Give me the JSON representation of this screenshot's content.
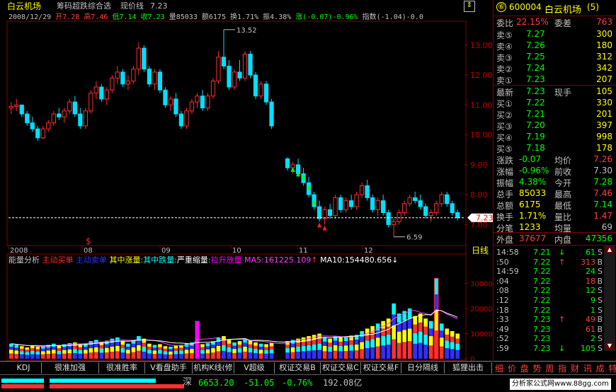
{
  "header": {
    "stock_name": "白云机场",
    "indicator": "筹码超跌综合选",
    "price_line_label": "现价线",
    "price_line_value": "7.23",
    "date": "2008/12/29",
    "open": "开7.28",
    "high": "高7.46",
    "low": "低7.14",
    "close": "收7.23",
    "volume": "量85033",
    "amount": "额6175",
    "turnover": "换1.71%",
    "amplitude": "振4.38%",
    "change": "涨(-0.07)-0.96%",
    "index": "指数(-1.04)-0.0"
  },
  "price_panel": {
    "y_ticks": [
      "13.00",
      "12.00",
      "11.00",
      "10.00",
      "9.00",
      "8.00",
      "7.00"
    ],
    "y_values": [
      13,
      12,
      11,
      10,
      9,
      8,
      7
    ],
    "ymin": 6.3,
    "ymax": 13.8,
    "current_price_tag": "7.23",
    "high_annotation": "13.52",
    "low_annotation": "6.59",
    "marker": "$",
    "x_labels": [
      "2008",
      "08",
      "09",
      "10",
      "11",
      "12"
    ],
    "period_label": "日线"
  },
  "volume_panel": {
    "title": "能量分析",
    "legend": [
      {
        "label": "主动买单",
        "color": "#ff3030"
      },
      {
        "label": "主动卖单",
        "color": "#3030ff"
      },
      {
        "label": "其中涨量",
        "color": "#ffff00"
      },
      {
        "label": "其中跌量",
        "color": "#00ffff"
      },
      {
        "label": "严重缩量",
        "color": "#ffffff"
      },
      {
        "label": "拉升放量",
        "color": "#ff00ff"
      }
    ],
    "ma5_label": "MA5:161225.109",
    "ma10_label": "MA10:154480.656",
    "y_ticks": [
      "300000",
      "200000",
      "100000",
      "0"
    ],
    "y_values": [
      300000,
      200000,
      100000,
      0
    ],
    "ymax": 380000
  },
  "chart_data": {
    "type": "candlestick",
    "y_range": [
      6.3,
      13.8
    ],
    "candles": [
      [
        10.9,
        11.1,
        10.7,
        10.95
      ],
      [
        10.95,
        11.2,
        10.8,
        11.0
      ],
      [
        11.0,
        11.0,
        10.6,
        10.7
      ],
      [
        10.7,
        10.8,
        10.3,
        10.4
      ],
      [
        10.4,
        10.6,
        10.1,
        10.2
      ],
      [
        10.2,
        10.3,
        9.8,
        9.9
      ],
      [
        9.9,
        10.3,
        9.85,
        10.2
      ],
      [
        10.2,
        10.5,
        10.1,
        10.4
      ],
      [
        10.4,
        10.8,
        10.3,
        10.7
      ],
      [
        10.7,
        10.9,
        10.5,
        10.6
      ],
      [
        10.6,
        10.9,
        10.4,
        10.8
      ],
      [
        10.8,
        11.2,
        10.7,
        11.1
      ],
      [
        11.1,
        11.3,
        10.6,
        10.7
      ],
      [
        10.7,
        10.9,
        10.2,
        10.3
      ],
      [
        10.3,
        10.9,
        10.2,
        10.8
      ],
      [
        10.8,
        11.5,
        10.7,
        11.4
      ],
      [
        11.4,
        11.8,
        11.2,
        11.6
      ],
      [
        11.6,
        11.7,
        11.1,
        11.2
      ],
      [
        11.2,
        11.6,
        11.0,
        11.5
      ],
      [
        11.5,
        12.0,
        11.4,
        11.9
      ],
      [
        11.9,
        12.3,
        11.7,
        12.1
      ],
      [
        12.1,
        12.2,
        11.6,
        11.7
      ],
      [
        11.7,
        12.0,
        11.5,
        11.8
      ],
      [
        11.8,
        12.3,
        11.7,
        12.2
      ],
      [
        12.2,
        13.1,
        12.0,
        12.9
      ],
      [
        12.9,
        13.0,
        12.1,
        12.2
      ],
      [
        12.2,
        12.3,
        11.6,
        11.7
      ],
      [
        11.7,
        12.2,
        11.5,
        12.1
      ],
      [
        12.1,
        12.2,
        11.4,
        11.5
      ],
      [
        11.5,
        11.6,
        10.9,
        11.0
      ],
      [
        11.0,
        11.3,
        10.8,
        11.2
      ],
      [
        11.2,
        11.4,
        10.6,
        10.7
      ],
      [
        10.7,
        10.8,
        10.2,
        10.3
      ],
      [
        10.3,
        10.9,
        10.2,
        10.8
      ],
      [
        10.8,
        11.2,
        10.7,
        11.1
      ],
      [
        11.1,
        11.4,
        10.9,
        11.3
      ],
      [
        11.3,
        11.5,
        10.8,
        10.9
      ],
      [
        10.9,
        11.4,
        10.8,
        11.3
      ],
      [
        11.3,
        11.9,
        11.2,
        11.8
      ],
      [
        11.8,
        12.8,
        11.7,
        12.6
      ],
      [
        12.6,
        13.52,
        12.2,
        12.3
      ],
      [
        12.3,
        12.5,
        11.5,
        11.6
      ],
      [
        11.6,
        12.2,
        11.5,
        12.1
      ],
      [
        12.1,
        12.5,
        11.8,
        11.9
      ],
      [
        11.9,
        12.8,
        11.8,
        12.7
      ],
      [
        12.7,
        12.8,
        11.9,
        12.0
      ],
      [
        12.0,
        12.1,
        11.2,
        11.3
      ],
      [
        11.3,
        11.8,
        11.2,
        11.7
      ],
      [
        11.7,
        11.8,
        11.0,
        11.1
      ],
      [
        11.1,
        11.2,
        10.2,
        10.3
      ],
      [
        null,
        null,
        null,
        null
      ],
      [
        null,
        null,
        null,
        null
      ],
      [
        9.2,
        9.25,
        8.8,
        8.9
      ],
      [
        8.9,
        9.1,
        8.7,
        9.0
      ],
      [
        9.0,
        9.2,
        8.6,
        8.7
      ],
      [
        8.7,
        8.9,
        8.3,
        8.4
      ],
      [
        8.4,
        8.6,
        7.9,
        8.0
      ],
      [
        8.0,
        8.1,
        7.5,
        7.6
      ],
      [
        7.6,
        7.8,
        7.1,
        7.2
      ],
      [
        7.2,
        7.6,
        7.0,
        7.5
      ],
      [
        7.5,
        7.7,
        7.2,
        7.3
      ],
      [
        7.3,
        8.0,
        7.2,
        7.9
      ],
      [
        7.9,
        8.0,
        7.4,
        7.5
      ],
      [
        7.5,
        7.9,
        7.4,
        7.8
      ],
      [
        7.8,
        8.0,
        7.5,
        7.6
      ],
      [
        7.6,
        8.1,
        7.5,
        8.0
      ],
      [
        8.0,
        8.4,
        7.9,
        8.3
      ],
      [
        8.3,
        8.5,
        7.8,
        7.9
      ],
      [
        7.9,
        8.0,
        7.4,
        7.5
      ],
      [
        7.5,
        7.9,
        7.3,
        7.8
      ],
      [
        7.8,
        8.0,
        7.3,
        7.4
      ],
      [
        7.4,
        7.5,
        6.9,
        7.0
      ],
      [
        7.0,
        7.2,
        6.59,
        7.1
      ],
      [
        7.1,
        7.5,
        7.0,
        7.4
      ],
      [
        7.4,
        7.8,
        7.3,
        7.7
      ],
      [
        7.7,
        8.0,
        7.6,
        7.9
      ],
      [
        7.9,
        8.1,
        7.7,
        7.8
      ],
      [
        7.8,
        8.0,
        7.5,
        7.6
      ],
      [
        7.6,
        7.7,
        7.2,
        7.3
      ],
      [
        7.3,
        7.5,
        7.1,
        7.4
      ],
      [
        7.4,
        7.8,
        7.3,
        7.7
      ],
      [
        7.7,
        8.1,
        7.6,
        8.0
      ],
      [
        8.0,
        8.1,
        7.6,
        7.7
      ],
      [
        7.7,
        7.8,
        7.3,
        7.4
      ],
      [
        7.4,
        7.5,
        7.14,
        7.23
      ]
    ],
    "volume": [
      60000,
      55000,
      50000,
      45000,
      52000,
      48000,
      50000,
      55000,
      60000,
      52000,
      58000,
      62000,
      65000,
      58000,
      60000,
      70000,
      75000,
      68000,
      72000,
      80000,
      85000,
      70000,
      60000,
      75000,
      90000,
      80000,
      60000,
      55000,
      58000,
      50000,
      48000,
      52000,
      55000,
      60000,
      65000,
      150000,
      58000,
      62000,
      70000,
      85000,
      90000,
      75000,
      65000,
      70000,
      80000,
      72000,
      65000,
      60000,
      58000,
      62000,
      0,
      0,
      70000,
      75000,
      80000,
      85000,
      90000,
      95000,
      100000,
      85000,
      80000,
      90000,
      85000,
      88000,
      92000,
      95000,
      110000,
      120000,
      130000,
      140000,
      150000,
      160000,
      220000,
      180000,
      190000,
      200000,
      170000,
      180000,
      160000,
      150000,
      320000,
      140000,
      120000,
      110000,
      100000
    ],
    "volume_range": [
      0,
      380000
    ]
  },
  "right_panel": {
    "code": "600004",
    "name": "白云机场",
    "suffix": "(5)",
    "weibi_label": "委比",
    "weibi_value": "22.15%",
    "weicha_label": "委差",
    "weicha_value": "763",
    "sell": [
      {
        "label": "卖⑤",
        "price": "7.27",
        "vol": "300"
      },
      {
        "label": "卖④",
        "price": "7.26",
        "vol": "180"
      },
      {
        "label": "卖③",
        "price": "7.25",
        "vol": "312"
      },
      {
        "label": "卖②",
        "price": "7.24",
        "vol": "342"
      },
      {
        "label": "卖①",
        "price": "7.23",
        "vol": "207"
      }
    ],
    "latest_label": "最新",
    "latest_value": "7.23",
    "now_hand_label": "现手",
    "now_hand_value": "105",
    "buy": [
      {
        "label": "买①",
        "price": "7.22",
        "vol": "330"
      },
      {
        "label": "买②",
        "price": "7.21",
        "vol": "201"
      },
      {
        "label": "买③",
        "price": "7.20",
        "vol": "397"
      },
      {
        "label": "买④",
        "price": "7.19",
        "vol": "998"
      },
      {
        "label": "买⑤",
        "price": "7.18",
        "vol": "178"
      }
    ],
    "stats": [
      {
        "l1": "涨跌",
        "v1": "-0.07",
        "l2": "均价",
        "v2": "7.26",
        "c2": "#ff4040"
      },
      {
        "l1": "涨幅",
        "v1": "-0.96%",
        "l2": "前收",
        "v2": "7.30",
        "c2": "#c0c0c0"
      },
      {
        "l1": "振幅",
        "v1": "4.38%",
        "l2": "今开",
        "v2": "7.28",
        "c2": "#00ff00"
      },
      {
        "l1": "总手",
        "v1": "85033",
        "l2": "最高",
        "v2": "7.46",
        "c2": "#ff4040"
      },
      {
        "l1": "总额",
        "v1": "6175",
        "l2": "最低",
        "v2": "7.14",
        "c2": "#00ff00"
      },
      {
        "l1": "换手",
        "v1": "1.71%",
        "l2": "量比",
        "v2": "1.47",
        "c2": "#ff4040"
      },
      {
        "l1": "分笔",
        "v1": "1233",
        "l2": "均量",
        "v2": "69",
        "c2": "#c0c0c0"
      }
    ],
    "outer_label": "外盘",
    "outer_value": "37677",
    "inner_label": "内盘",
    "inner_value": "47356",
    "ticks": [
      {
        "time": "14:58",
        "price": "7.21",
        "arrow": "↓",
        "vol": "61",
        "flag": "S"
      },
      {
        "time": ":50",
        "price": "7.22",
        "arrow": "↑",
        "vol": "313",
        "flag": "B"
      },
      {
        "time": "14:59",
        "price": "7.22",
        "arrow": "",
        "vol": "24",
        "flag": "S"
      },
      {
        "time": ":04",
        "price": "7.22",
        "arrow": "",
        "vol": "18",
        "flag": "B"
      },
      {
        "time": ":08",
        "price": "7.22",
        "arrow": "",
        "vol": "12",
        "flag": "S"
      },
      {
        "time": ":12",
        "price": "7.22",
        "arrow": "",
        "vol": "9",
        "flag": "S"
      },
      {
        "time": ":18",
        "price": "7.22",
        "arrow": "",
        "vol": "1",
        "flag": "S"
      },
      {
        "time": ":33",
        "price": "7.23",
        "arrow": "↑",
        "vol": "49",
        "flag": "B"
      },
      {
        "time": ":49",
        "price": "7.23",
        "arrow": "",
        "vol": "61",
        "flag": "B"
      },
      {
        "time": ":52",
        "price": "7.23",
        "arrow": "",
        "vol": "2",
        "flag": "S"
      },
      {
        "time": ":59",
        "price": "7.23",
        "arrow": "↓",
        "vol": "105",
        "flag": "S"
      }
    ],
    "bottom_tabs": "细 价 盘 势 周 指 财 讯 成 特 制"
  },
  "tabs": [
    "KDJ",
    "很准加强",
    "很准胜率",
    "V看盘助手",
    "机构K线(修",
    "V超级MACD",
    "权证交易B",
    "权证交易C",
    "权证交易F",
    "日分隔线",
    "狐狸出击"
  ],
  "status": {
    "market": "深",
    "index_value": "6653.20",
    "change": "-51.05",
    "change_pct": "-0.76%",
    "amount": "192.08亿",
    "watermark": "分析家公式网www.88gg.com"
  },
  "colors": {
    "up": "#ff3030",
    "down": "#00e0ff",
    "frame": "#800000",
    "accent_yellow": "#ffff00"
  }
}
